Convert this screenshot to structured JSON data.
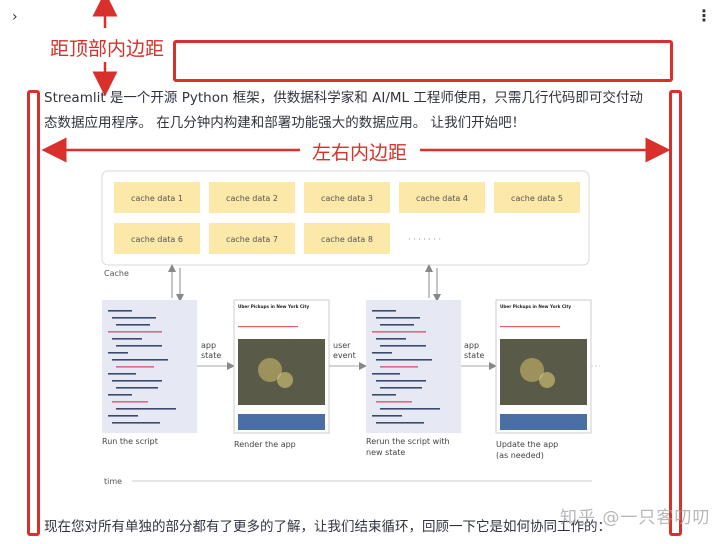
{
  "toolbar": {
    "expand_icon": "chevron-right-icon",
    "menu_icon": "kebab-menu-icon",
    "expand_glyph": "›",
    "menu_glyph": "⋮"
  },
  "annotations": {
    "top_padding_label": "距顶部内边距",
    "side_padding_label": "左右内边距",
    "color": "#d9302c"
  },
  "content": {
    "intro_line1": "Streamlit 是一个开源 Python 框架，供数据科学家和 AI/ML 工程师使用，只需几行代码即可交付动",
    "intro_line2": "态数据应用程序。 在几分钟内构建和部署功能强大的数据应用。 让我们开始吧！",
    "closing": "现在您对所有单独的部分都有了更多的了解，让我们结束循环，回顾一下它是如何协同工作的："
  },
  "diagram": {
    "cache_items": [
      "cache data 1",
      "cache data 2",
      "cache data 3",
      "cache data 4",
      "cache data 5",
      "cache data 6",
      "cache data 7",
      "cache data 8"
    ],
    "cache_ellipsis": "· · · · · · ·",
    "cache_label": "Cache",
    "arrow_labels": [
      "app",
      "state",
      "user",
      "event",
      "app",
      "state"
    ],
    "step_labels": [
      "Run the script",
      "Render the app",
      "Rerun the script with",
      "new state",
      "Update the app",
      "(as needed)"
    ],
    "time_label": "time",
    "panel_title": "Uber Pickups in New York City",
    "cache_color": "#fce8a8"
  },
  "watermark": "知乎 @一只客叨叨"
}
